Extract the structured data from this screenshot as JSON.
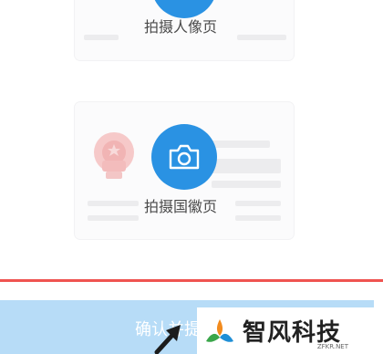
{
  "portrait_card": {
    "caption": "拍摄人像页"
  },
  "emblem_card": {
    "caption": "拍摄国徽页"
  },
  "confirm": {
    "label": "确认并提"
  },
  "watermark": {
    "brand": "智风科技",
    "site": "ZFKR.NET"
  },
  "colors": {
    "accent": "#2a92e3",
    "confirm_bg": "#b7dcf7",
    "highlight_border": "#ef5350"
  },
  "icons": [
    "camera-icon",
    "emblem-icon",
    "arrow-cursor-icon",
    "logo-icon"
  ]
}
